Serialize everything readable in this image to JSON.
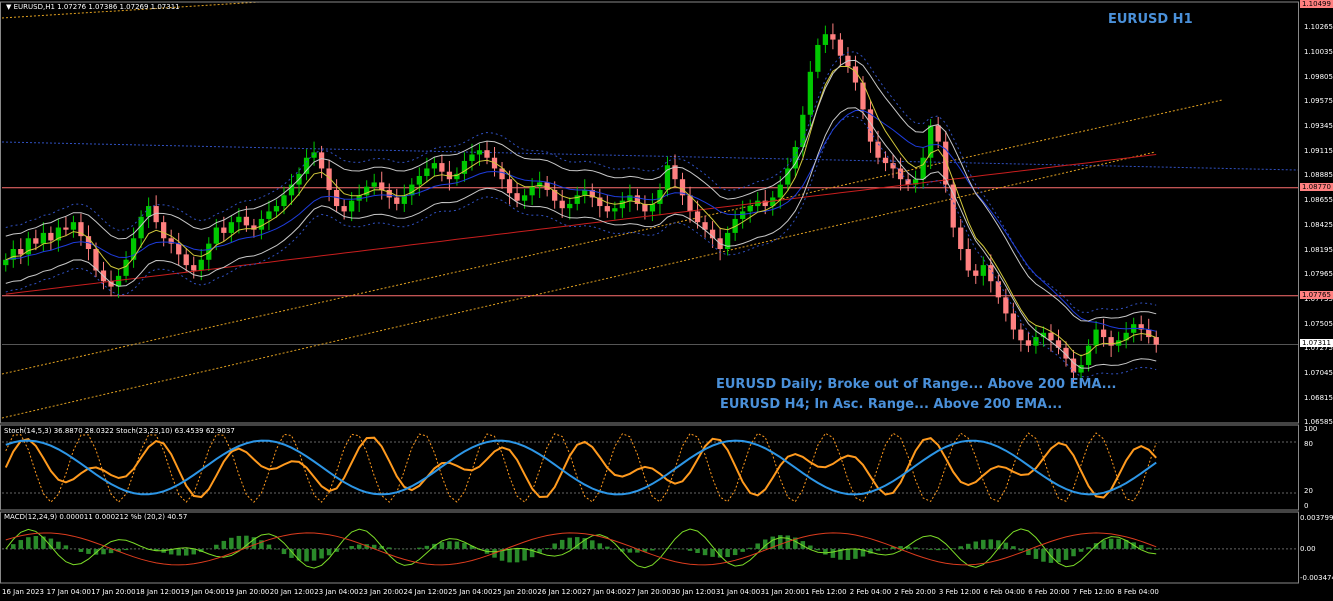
{
  "window": {
    "symbol_info": "EURUSD,H1  1.07276 1.07386 1.07269 1.07311",
    "chart_title": "EURUSD H1"
  },
  "annotations": {
    "note1": "EURUSD Daily; Broke out of Range... Above 200 EMA...",
    "note2": "EURUSD H4; In Asc. Range... Above 200 EMA..."
  },
  "price_axis": {
    "ticks": [
      "1.10499",
      "1.10265",
      "1.10035",
      "1.09805",
      "1.09575",
      "1.09345",
      "1.09115",
      "1.08885",
      "1.08655",
      "1.08425",
      "1.08195",
      "1.07965",
      "1.07735",
      "1.07505",
      "1.07275",
      "1.07045",
      "1.06815",
      "1.06585"
    ],
    "tags": [
      {
        "label": "1.10499",
        "color": "#ff8080"
      },
      {
        "label": "1.08770",
        "color": "#ff8080"
      },
      {
        "label": "1.07765",
        "color": "#ff8080"
      },
      {
        "label": "1.07311",
        "color": "#ffffff"
      }
    ]
  },
  "stoch": {
    "label": "Stoch(14,5,3) 36.8870 28.0322  Stoch(23,23,10) 63.4539 62.9037",
    "levels": [
      "100",
      "80",
      "20",
      "0"
    ]
  },
  "macd": {
    "label": "MACD(12,24,9) 0.000011 0.000212  %b (20,2) 40.57",
    "levels": [
      "0.003799",
      "0.00",
      "-0.003474"
    ]
  },
  "time_axis": [
    "16 Jan 2023",
    "17 Jan 04:00",
    "17 Jan 20:00",
    "18 Jan 12:00",
    "19 Jan 04:00",
    "19 Jan 20:00",
    "20 Jan 12:00",
    "23 Jan 04:00",
    "23 Jan 20:00",
    "24 Jan 12:00",
    "25 Jan 04:00",
    "25 Jan 20:00",
    "26 Jan 12:00",
    "27 Jan 04:00",
    "27 Jan 20:00",
    "30 Jan 12:00",
    "31 Jan 04:00",
    "31 Jan 20:00",
    "1 Feb 12:00",
    "2 Feb 04:00",
    "2 Feb 20:00",
    "3 Feb 12:00",
    "6 Feb 04:00",
    "6 Feb 20:00",
    "7 Feb 12:00",
    "8 Feb 04:00"
  ],
  "colors": {
    "bull": "#00c800",
    "bear": "#ff8080",
    "ema200": "#c81e1e",
    "ema_blue": "#1e3cdc",
    "ema_yellow": "#d2c83c",
    "bb": "#c8c8c8",
    "trend": "#e0a020",
    "stoch_fast": "#ff9a1e",
    "stoch_slow": "#2d96e6",
    "macd_line": "#7cdc28",
    "macd_signal": "#dc3c1e"
  },
  "closes": [
    1.081,
    1.082,
    1.0815,
    1.083,
    1.0825,
    1.0835,
    1.0828,
    1.084,
    1.0838,
    1.0845,
    1.0832,
    1.082,
    1.08,
    1.079,
    1.0785,
    1.0795,
    1.081,
    1.083,
    1.085,
    1.086,
    1.0845,
    1.083,
    1.0825,
    1.0815,
    1.0805,
    1.08,
    1.081,
    1.0825,
    1.084,
    1.0835,
    1.0845,
    1.085,
    1.0842,
    1.0838,
    1.0848,
    1.0855,
    1.086,
    1.087,
    1.088,
    1.089,
    1.0905,
    1.091,
    1.0895,
    1.0875,
    1.086,
    1.0855,
    1.0865,
    1.087,
    1.0878,
    1.0882,
    1.0875,
    1.0868,
    1.0862,
    1.087,
    1.088,
    1.0888,
    1.0895,
    1.09,
    1.0892,
    1.0885,
    1.089,
    1.0902,
    1.0908,
    1.0912,
    1.0905,
    1.0895,
    1.0885,
    1.0872,
    1.0865,
    1.087,
    1.0878,
    1.0882,
    1.0875,
    1.0865,
    1.0858,
    1.0862,
    1.087,
    1.0875,
    1.0868,
    1.086,
    1.0855,
    1.0858,
    1.0865,
    1.087,
    1.0862,
    1.0855,
    1.0862,
    1.0875,
    1.0898,
    1.0885,
    1.087,
    1.0855,
    1.0845,
    1.0838,
    1.083,
    1.082,
    1.0835,
    1.0848,
    1.0855,
    1.086,
    1.0865,
    1.086,
    1.0868,
    1.088,
    1.0895,
    1.0915,
    1.0945,
    1.0985,
    1.101,
    1.102,
    1.1015,
    1.1,
    1.099,
    1.0975,
    1.095,
    1.092,
    1.0905,
    1.09,
    1.0895,
    1.0885,
    1.088,
    1.0885,
    1.0905,
    1.0935,
    1.092,
    1.088,
    1.084,
    1.082,
    1.08,
    1.0795,
    1.0805,
    1.079,
    1.0775,
    1.076,
    1.0745,
    1.0735,
    1.073,
    1.0738,
    1.0742,
    1.0735,
    1.0728,
    1.0718,
    1.0705,
    1.0712,
    1.073,
    1.0745,
    1.0738,
    1.073,
    1.0735,
    1.0742,
    1.075,
    1.0745,
    1.0738,
    1.0731
  ]
}
